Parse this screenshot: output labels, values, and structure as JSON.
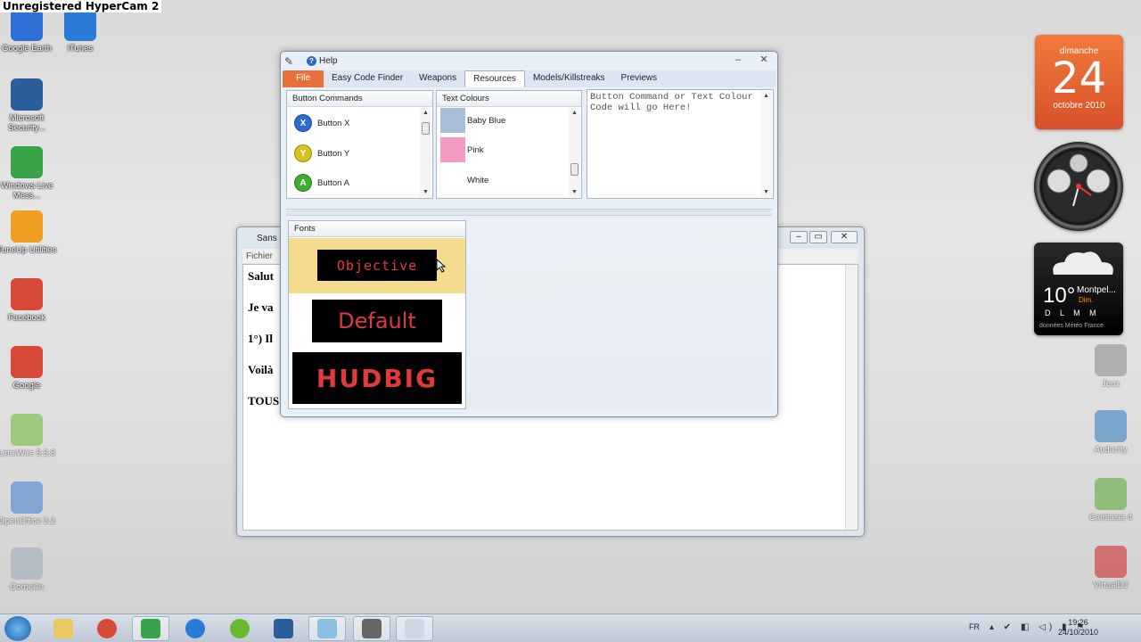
{
  "watermark": "Unregistered HyperCam 2",
  "desktop_left": [
    {
      "label": "Google Earth",
      "icon": "google-earth-icon",
      "color": "#2f6fd6"
    },
    {
      "label": "iTunes",
      "icon": "itunes-icon",
      "color": "#2a7bd8"
    },
    {
      "label": "Microsoft Security...",
      "icon": "microsoft-security-icon",
      "color": "#2c5e9a"
    },
    {
      "label": "Windows Live Mess...",
      "icon": "windows-live-messenger-icon",
      "color": "#3aa34a"
    },
    {
      "label": "TuneUp Utilities",
      "icon": "tuneup-icon",
      "color": "#f0a020"
    },
    {
      "label": "Facebook",
      "icon": "chrome-icon",
      "color": "#d84a38"
    },
    {
      "label": "Google",
      "icon": "chrome-icon",
      "color": "#d84a38"
    },
    {
      "label": "LimeWire 5.5.8",
      "icon": "limewire-icon",
      "color": "#6ab830"
    },
    {
      "label": "OpenOffice 3.2",
      "icon": "openoffice-icon",
      "color": "#3a7fd0"
    },
    {
      "label": "Corbeille",
      "icon": "recycle-bin-icon",
      "color": "#9aa8b6"
    }
  ],
  "desktop_right": [
    {
      "label": "Jeux",
      "icon": "games-icon",
      "color": "#888888"
    },
    {
      "label": "Audacity",
      "icon": "audacity-icon",
      "color": "#2a7ac0"
    },
    {
      "label": "Camtasia 4",
      "icon": "camtasia-icon",
      "color": "#58a830"
    },
    {
      "label": "VirtualDJ",
      "icon": "virtualdj-icon",
      "color": "#cc2020"
    }
  ],
  "calendar": {
    "weekday": "dimanche",
    "day": "24",
    "month": "octobre 2010"
  },
  "weather": {
    "temp": "10°",
    "city": "Montpel...",
    "sub": "Dim.",
    "days": "D L M M",
    "source": "données Météo France"
  },
  "back_window": {
    "title": "Sans t",
    "menu": "Fichier",
    "lines": [
      "Salut",
      "Je va",
      "1°) Il",
      "Voilà",
      "TOUS"
    ]
  },
  "app": {
    "title": "Help",
    "tabs": [
      {
        "label": "File",
        "kind": "file"
      },
      {
        "label": "Easy Code Finder",
        "kind": "normal"
      },
      {
        "label": "Weapons",
        "kind": "normal"
      },
      {
        "label": "Resources",
        "kind": "active"
      },
      {
        "label": "Models/Killstreaks",
        "kind": "normal"
      },
      {
        "label": "Previews",
        "kind": "normal"
      }
    ],
    "button_commands": {
      "header": "Button Commands",
      "items": [
        {
          "label": "Button X",
          "glyph": "X",
          "color": "#2f6ad0"
        },
        {
          "label": "Button Y",
          "glyph": "Y",
          "color": "#d6c21e"
        },
        {
          "label": "Button A",
          "glyph": "A",
          "color": "#3fae2e"
        }
      ]
    },
    "text_colours": {
      "header": "Text Colours",
      "items": [
        {
          "label": "Baby Blue",
          "color": "#a9bed8"
        },
        {
          "label": "Pink",
          "color": "#f49bc4"
        },
        {
          "label": "White",
          "color": "#ffffff"
        }
      ]
    },
    "output_text": "Button Command or Text Colour Code will go Here!",
    "fonts": {
      "header": "Fonts",
      "items": [
        {
          "label": "Objective",
          "selected": true
        },
        {
          "label": "Default",
          "selected": false
        },
        {
          "label": "HUDBIG",
          "selected": false
        }
      ]
    }
  },
  "tray": {
    "lang": "FR",
    "time": "19:26",
    "date": "24/10/2010"
  }
}
